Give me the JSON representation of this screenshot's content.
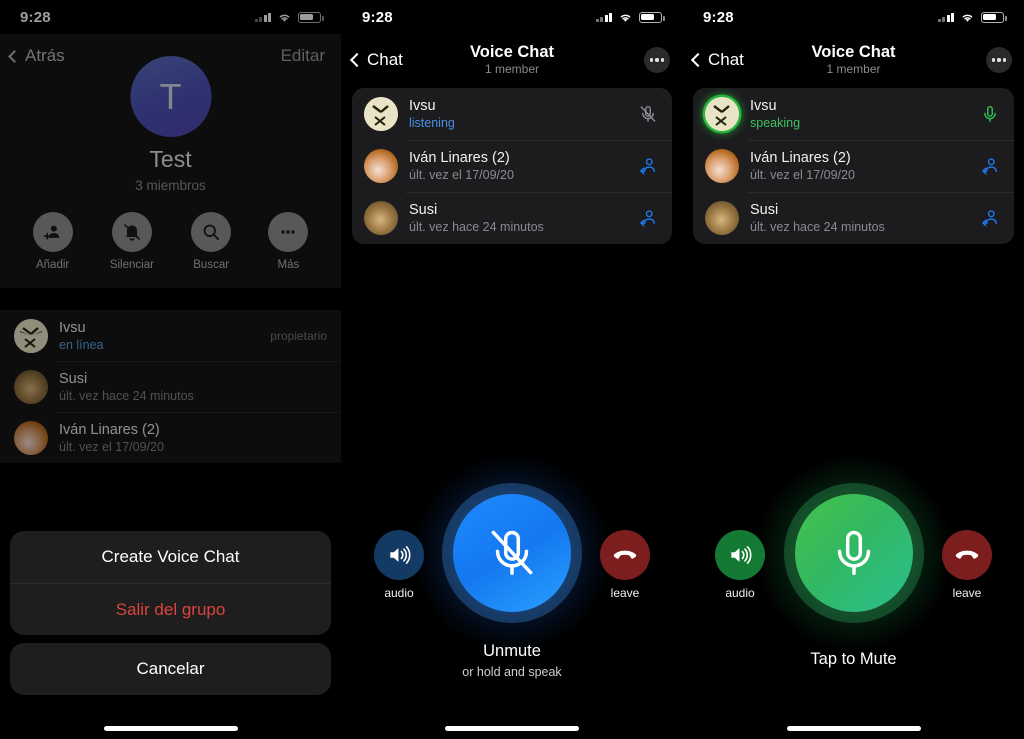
{
  "statusbar": {
    "time": "9:28"
  },
  "panel1": {
    "nav": {
      "back_label": "Atrás",
      "edit_label": "Editar"
    },
    "group": {
      "avatar_initial": "T",
      "avatar_color": "#4f4fb4",
      "title": "Test",
      "members_count": "3 miembros"
    },
    "actions": [
      {
        "label": "Añadir",
        "icon": "add-user-icon"
      },
      {
        "label": "Silenciar",
        "icon": "bell-slash-icon"
      },
      {
        "label": "Buscar",
        "icon": "search-icon"
      },
      {
        "label": "Más",
        "icon": "ellipsis-icon"
      }
    ],
    "members": [
      {
        "name": "Ivsu",
        "status": "en línea",
        "status_kind": "online",
        "badge": "propietario",
        "avatar": "ivsu"
      },
      {
        "name": "Susi",
        "status": "últ. vez hace 24 minutos",
        "status_kind": "offline",
        "badge": "",
        "avatar": "susi"
      },
      {
        "name": "Iván Linares (2)",
        "status": "últ. vez el 17/09/20",
        "status_kind": "offline",
        "badge": "",
        "avatar": "ivan"
      }
    ],
    "action_sheet": {
      "create_voice_chat": "Create Voice Chat",
      "leave_group": "Salir del grupo",
      "cancel": "Cancelar"
    }
  },
  "panel2": {
    "nav": {
      "back_label": "Chat",
      "title": "Voice Chat",
      "subtitle": "1 member",
      "more_icon": "ellipsis-icon"
    },
    "participants": [
      {
        "name": "Ivsu",
        "status": "listening",
        "status_kind": "listening",
        "avatar": "ivsu",
        "right_icon": "mic-muted-icon",
        "speaking": false
      },
      {
        "name": "Iván Linares (2)",
        "status": "últ. vez el 17/09/20",
        "status_kind": "offline",
        "avatar": "ivan",
        "right_icon": "invite-user-icon",
        "speaking": false
      },
      {
        "name": "Susi",
        "status": "últ. vez hace 24 minutos",
        "status_kind": "offline",
        "avatar": "susi",
        "right_icon": "invite-user-icon",
        "speaking": false
      }
    ],
    "controls": {
      "accent": "#1f8bff",
      "main_icon": "mic-muted-icon",
      "main_title": "Unmute",
      "main_subtitle": "or hold and speak",
      "audio_label": "audio",
      "audio_icon": "speaker-icon",
      "leave_label": "leave",
      "leave_icon": "hangup-icon"
    }
  },
  "panel3": {
    "nav": {
      "back_label": "Chat",
      "title": "Voice Chat",
      "subtitle": "1 member",
      "more_icon": "ellipsis-icon"
    },
    "participants": [
      {
        "name": "Ivsu",
        "status": "speaking",
        "status_kind": "speaking",
        "avatar": "ivsu",
        "right_icon": "mic-icon",
        "speaking": true
      },
      {
        "name": "Iván Linares (2)",
        "status": "últ. vez el 17/09/20",
        "status_kind": "offline",
        "avatar": "ivan",
        "right_icon": "invite-user-icon",
        "speaking": false
      },
      {
        "name": "Susi",
        "status": "últ. vez hace 24 minutos",
        "status_kind": "offline",
        "avatar": "susi",
        "right_icon": "invite-user-icon",
        "speaking": false
      }
    ],
    "controls": {
      "accent": "#3bbd55",
      "main_icon": "mic-icon",
      "main_title": "Tap to Mute",
      "main_subtitle": "",
      "audio_label": "audio",
      "audio_icon": "speaker-icon",
      "leave_label": "leave",
      "leave_icon": "hangup-icon"
    }
  }
}
